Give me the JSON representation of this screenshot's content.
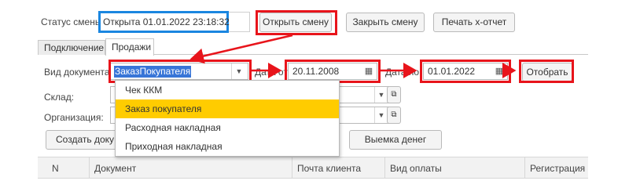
{
  "header": {
    "status_label": "Статус смены:",
    "status_value": "Открыта 01.01.2022 23:18:32",
    "open_shift": "Открыть смену",
    "close_shift": "Закрыть смену",
    "x_report": "Печать х-отчет"
  },
  "tabs": [
    {
      "label": "Подключение"
    },
    {
      "label": "Продажи"
    }
  ],
  "filters": {
    "doc_type_label": "Вид документа:",
    "doc_type_value": "ЗаказПокупателя",
    "date_from_label": "Дата от:",
    "date_from_value": "20.11.2008",
    "date_to_label": "Дата по:",
    "date_to_value": "01.01.2022",
    "select_button": "Отобрать",
    "warehouse_label": "Склад:",
    "org_label": "Организация:"
  },
  "dropdown": {
    "options": [
      {
        "label": "Чек ККМ",
        "selected": false
      },
      {
        "label": "Заказ покупателя",
        "selected": true
      },
      {
        "label": "Расходная накладная",
        "selected": false
      },
      {
        "label": "Приходная накладная",
        "selected": false
      }
    ],
    "highlight_color": "#ffcc00"
  },
  "actions": {
    "create_doc": "Создать доку",
    "cash_withdrawal": "Выемка денег"
  },
  "table": {
    "columns": [
      "N",
      "Документ",
      "Почта клиента",
      "Вид оплаты",
      "Регистрация"
    ]
  },
  "colors": {
    "annotation_red": "#e8141b",
    "annotation_blue": "#1a86e0",
    "selection_blue": "#3875d7"
  }
}
